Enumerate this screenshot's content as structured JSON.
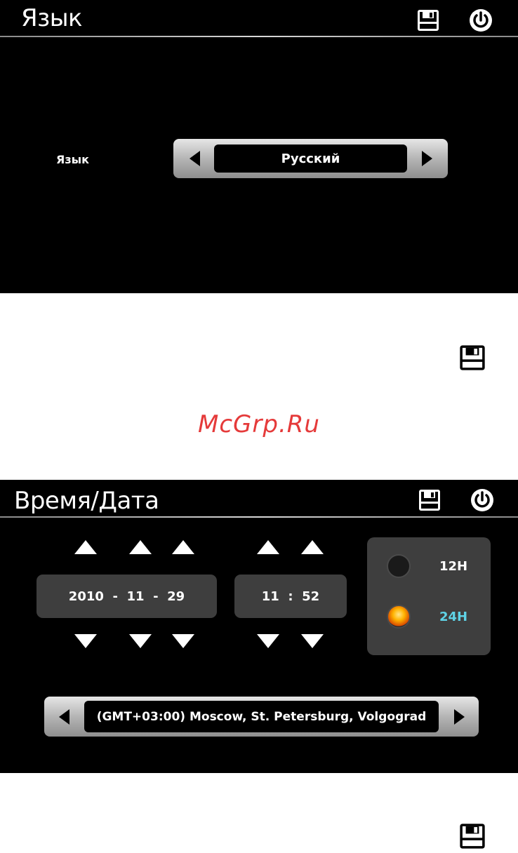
{
  "language_screen": {
    "title": "Язык",
    "field_label": "Язык",
    "selected_language": "Русский"
  },
  "watermark": "McGrp.Ru",
  "time_date_screen": {
    "title": "Время/Дата",
    "date": {
      "year": "2010",
      "month": "11",
      "day": "29",
      "separator": "-"
    },
    "time": {
      "hour": "11",
      "minute": "52",
      "separator": ":"
    },
    "hour_format": {
      "options": [
        "12H",
        "24H"
      ],
      "selected": "24H",
      "label_color": "#ffffff",
      "selected_label_color": "#5fd3e6"
    },
    "timezone": "(GMT+03:00) Moscow, St. Petersburg, Volgograd"
  },
  "icons": {
    "save": "save-icon",
    "power": "power-icon"
  }
}
